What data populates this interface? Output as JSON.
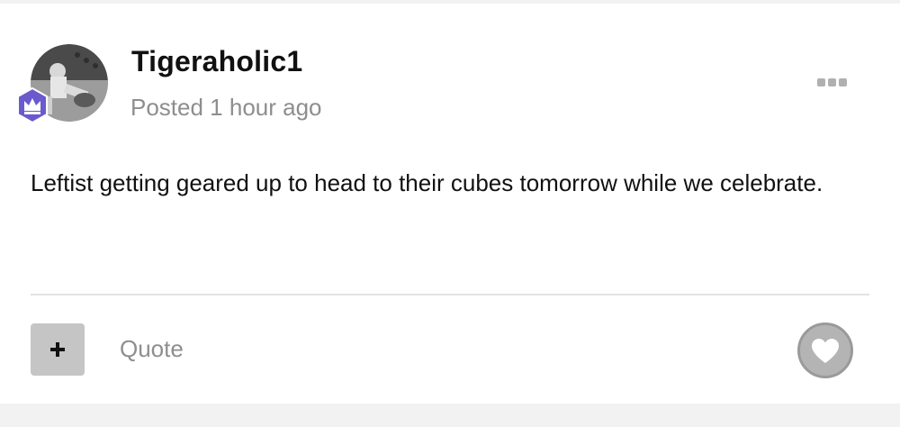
{
  "post": {
    "author": "Tigeraholic1",
    "posted": "Posted 1 hour ago",
    "body": "Leftist getting geared up to head to their cubes tomorrow while we celebrate."
  },
  "actions": {
    "quote_label": "Quote"
  },
  "icons": {
    "more": "more-options-icon",
    "plus": "plus-icon",
    "like": "heart-icon",
    "badge": "crown-badge-icon"
  },
  "colors": {
    "badge": "#6a5acd",
    "muted_text": "#8e8e8e",
    "button_gray": "#c5c5c5"
  }
}
